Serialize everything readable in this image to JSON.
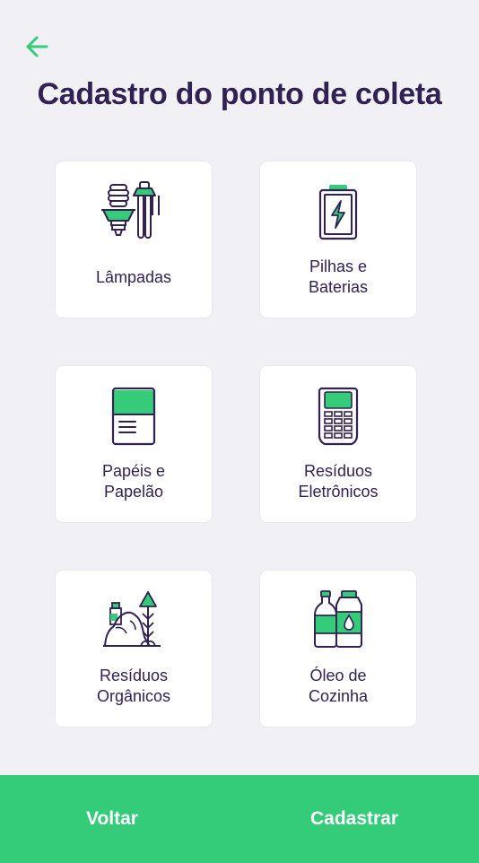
{
  "header": {
    "back_icon": "arrow-left-icon",
    "title": "Cadastro do ponto de coleta"
  },
  "items": [
    {
      "label": "Lâmpadas",
      "icon": "lamps-icon"
    },
    {
      "label": "Pilhas e\nBaterias",
      "icon": "battery-icon"
    },
    {
      "label": "Papéis e\nPapelão",
      "icon": "paper-icon"
    },
    {
      "label": "Resíduos\nEletrônicos",
      "icon": "electronics-icon"
    },
    {
      "label": "Resíduos\nOrgânicos",
      "icon": "organic-icon"
    },
    {
      "label": "Óleo de\nCozinha",
      "icon": "oil-icon"
    }
  ],
  "footer": {
    "back_label": "Voltar",
    "submit_label": "Cadastrar"
  },
  "colors": {
    "accent": "#34cb79",
    "title": "#322153",
    "background": "#f0f0f5"
  }
}
